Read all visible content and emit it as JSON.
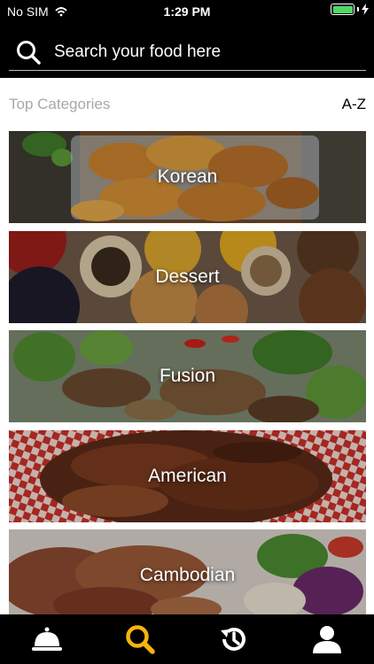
{
  "status_bar": {
    "carrier": "No SIM",
    "time": "1:29 PM",
    "charging_icon": "bolt-icon",
    "wifi_icon": "wifi-icon"
  },
  "search": {
    "placeholder": "Search your food here",
    "value": ""
  },
  "section": {
    "title": "Top Categories",
    "sort_label": "A-Z"
  },
  "categories": [
    {
      "label": "Korean",
      "image": "fried-chicken-photo"
    },
    {
      "label": "Dessert",
      "image": "tarts-photo"
    },
    {
      "label": "Fusion",
      "image": "salad-meat-photo"
    },
    {
      "label": "American",
      "image": "ribs-photo"
    },
    {
      "label": "Cambodian",
      "image": "grilled-pork-photo"
    }
  ],
  "tab_bar": {
    "tabs": [
      {
        "name": "restaurant-tab",
        "icon": "cloche-icon",
        "active": false
      },
      {
        "name": "search-tab",
        "icon": "search-icon",
        "active": true
      },
      {
        "name": "history-tab",
        "icon": "history-icon",
        "active": false
      },
      {
        "name": "profile-tab",
        "icon": "user-icon",
        "active": false
      }
    ]
  },
  "colors": {
    "header_bg": "#000000",
    "active_tab": "#f5b50a",
    "inactive_tab": "#ffffff",
    "battery": "#4cd964",
    "section_title": "#a8a8a8"
  }
}
